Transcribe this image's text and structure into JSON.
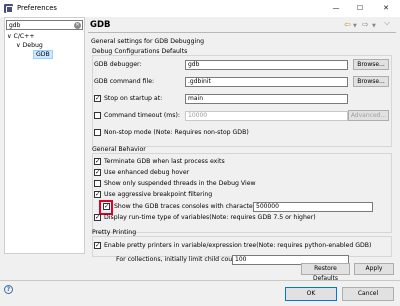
{
  "window": {
    "title": "Preferences",
    "controls": {
      "minimize": "—",
      "maximize": "☐",
      "close": "✕"
    }
  },
  "sidebar": {
    "filter_value": "gdb",
    "tree": [
      {
        "label": "C/C++",
        "expander": "∨"
      },
      {
        "label": "Debug",
        "expander": "∨"
      },
      {
        "label": "GDB"
      }
    ]
  },
  "page": {
    "title": "GDB",
    "nav_back": "⇦",
    "nav_fwd": "⇨",
    "menu_chevron": "⌵",
    "description": "General settings for GDB Debugging"
  },
  "defaults_group": {
    "title": "Debug Configurations Defaults",
    "gdb_debugger_label": "GDB debugger:",
    "gdb_debugger_value": "gdb",
    "gdb_command_file_label": "GDB command file:",
    "gdb_command_file_value": ".gdbinit",
    "browse_label": "Browse...",
    "stop_on_startup_label": "Stop on startup at:",
    "stop_on_startup_value": "main",
    "command_timeout_label": "Command timeout (ms):",
    "command_timeout_value": "10000",
    "advanced_label": "Advanced...",
    "nonstop_label": "Non-stop mode (Note: Requires non-stop GDB)"
  },
  "general_behavior": {
    "title": "General Behavior",
    "options": [
      "Terminate GDB when last process exits",
      "Use enhanced debug hover",
      "Show only suspended threads in the Debug View",
      "Use aggressive breakpoint filtering",
      "Show the GDB traces consoles with character limit:",
      "Display run-time type of variables(Note: requires GDB 7.5 or higher)"
    ],
    "char_limit_value": "500000"
  },
  "pretty_printing": {
    "title": "Pretty Printing",
    "enable_label": "Enable pretty printers in variable/expression tree(Note: requires python-enabled GDB)",
    "child_count_label": "For collections, initially limit child count to",
    "child_count_value": "100"
  },
  "buttons": {
    "restore_defaults": "Restore Defaults",
    "apply": "Apply",
    "ok": "OK",
    "cancel": "Cancel",
    "help": "?"
  }
}
